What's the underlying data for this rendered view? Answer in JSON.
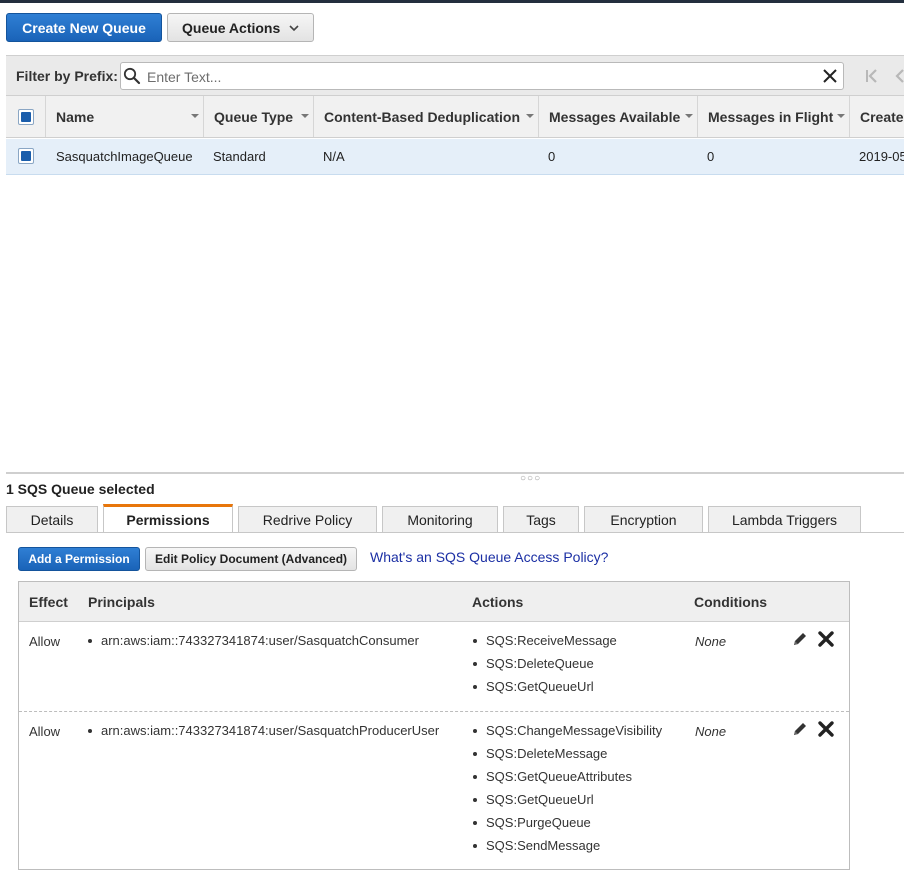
{
  "toolbar": {
    "create_label": "Create New Queue",
    "actions_label": "Queue Actions"
  },
  "filter": {
    "label": "Filter by Prefix:",
    "placeholder": "Enter Text..."
  },
  "grid": {
    "columns": [
      "Name",
      "Queue Type",
      "Content-Based Deduplication",
      "Messages Available",
      "Messages in Flight",
      "Create"
    ],
    "rows": [
      {
        "name": "SasquatchImageQueue",
        "queue_type": "Standard",
        "dedup": "N/A",
        "available": "0",
        "in_flight": "0",
        "created": "2019-05"
      }
    ]
  },
  "details": {
    "selected_text": "1 SQS Queue selected",
    "tabs": [
      "Details",
      "Permissions",
      "Redrive Policy",
      "Monitoring",
      "Tags",
      "Encryption",
      "Lambda Triggers"
    ],
    "active_tab": "Permissions"
  },
  "permissions": {
    "add_label": "Add a Permission",
    "edit_label": "Edit Policy Document (Advanced)",
    "help_link": "What's an SQS Queue Access Policy?",
    "headers": {
      "effect": "Effect",
      "principals": "Principals",
      "actions": "Actions",
      "conditions": "Conditions"
    },
    "rows": [
      {
        "effect": "Allow",
        "principals": [
          "arn:aws:iam::743327341874:user/SasquatchConsumer"
        ],
        "actions": [
          "SQS:ReceiveMessage",
          "SQS:DeleteQueue",
          "SQS:GetQueueUrl"
        ],
        "conditions": "None"
      },
      {
        "effect": "Allow",
        "principals": [
          "arn:aws:iam::743327341874:user/SasquatchProducerUser"
        ],
        "actions": [
          "SQS:ChangeMessageVisibility",
          "SQS:DeleteMessage",
          "SQS:GetQueueAttributes",
          "SQS:GetQueueUrl",
          "SQS:PurgeQueue",
          "SQS:SendMessage"
        ],
        "conditions": "None"
      }
    ]
  },
  "colors": {
    "primary_button": "#1a63b8",
    "selected_row": "#e5eff9",
    "active_tab_accent": "#e8760a",
    "link": "#1b2fa4"
  },
  "icons": {
    "search": "search-icon",
    "clear": "close-icon",
    "first_page": "first-page-icon",
    "prev_page": "prev-page-icon",
    "edit": "pencil-icon",
    "delete": "delete-x-icon",
    "dropdown": "chevron-down-icon"
  }
}
